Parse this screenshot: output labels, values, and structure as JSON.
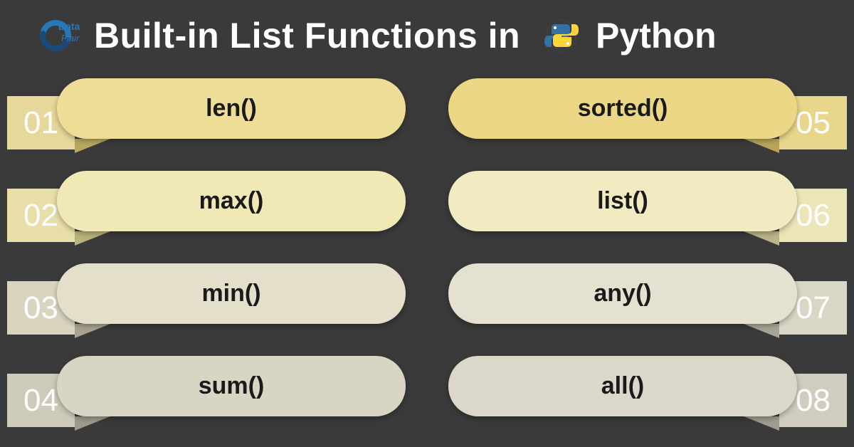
{
  "header": {
    "title": "Built-in List Functions in",
    "language": "Python",
    "brand": "Data Flair"
  },
  "left_items": [
    {
      "num": "01",
      "label": "len()"
    },
    {
      "num": "02",
      "label": "max()"
    },
    {
      "num": "03",
      "label": "min()"
    },
    {
      "num": "04",
      "label": "sum()"
    }
  ],
  "right_items": [
    {
      "num": "05",
      "label": "sorted()"
    },
    {
      "num": "06",
      "label": "list()"
    },
    {
      "num": "07",
      "label": "any()"
    },
    {
      "num": "08",
      "label": "all()"
    }
  ]
}
